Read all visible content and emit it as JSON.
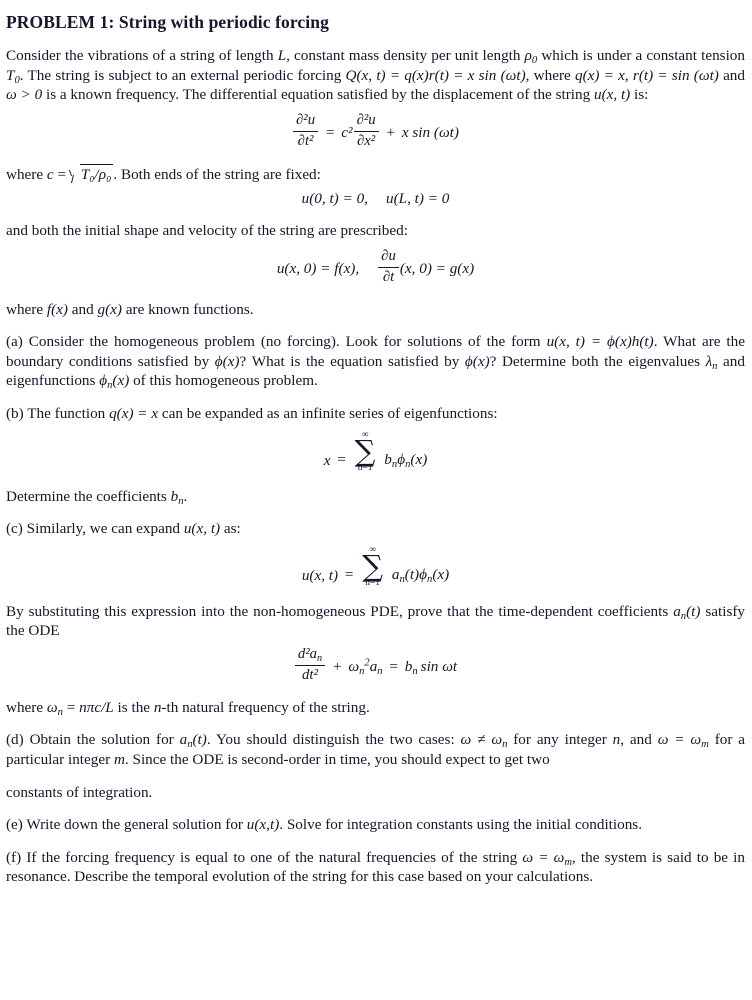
{
  "document": {
    "title": "PROBLEM 1: String with periodic forcing",
    "text_color": "#16162c",
    "background_color": "#ffffff"
  },
  "intro": {
    "p1_a": "Consider the vibrations of a string of length ",
    "p1_L": "L",
    "p1_b": ", constant mass density per unit length ",
    "p1_rho": "ρ",
    "p1_rho_sub": "0",
    "p1_c": " which is under a constant tension ",
    "p1_T": "T",
    "p1_T_sub": "0",
    "p1_d": ". The string is subject to an external periodic forcing ",
    "p1_Q": "Q(x, t) = q(x)r(t) = x sin (ωt)",
    "p1_e": ", where ",
    "p1_qx": "q(x) = x",
    "p1_f": ", ",
    "p1_rt": "r(t) = sin (ωt)",
    "p1_g": " and ",
    "p1_omega": "ω > 0",
    "p1_h": " is a known frequency. The differential equation satisfied by the displacement of the string ",
    "p1_u": "u(x, t)",
    "p1_i": " is:"
  },
  "eq_pde": {
    "label": "wave-equation-with-forcing",
    "lhs_num": "∂²u",
    "lhs_den": "∂t²",
    "equals": "=",
    "coef": "c²",
    "rhs_num": "∂²u",
    "rhs_den": "∂x²",
    "plus": "+",
    "forcing": "x sin (ωt)"
  },
  "wave_speed": {
    "prefix": "where ",
    "c": "c",
    "equals": " = ",
    "radicand": "T₀/ρ₀",
    "suffix": ". Both ends of the string are fixed:"
  },
  "eq_bc": {
    "label": "boundary-conditions",
    "left": "u(0, t) = 0,",
    "right": "u(L, t) = 0"
  },
  "initial_lead": "and both the initial shape and velocity of the string are prescribed:",
  "eq_ic": {
    "label": "initial-conditions",
    "left": "u(x, 0) = f(x),",
    "du_num": "∂u",
    "du_den": "∂t",
    "right": "(x, 0) = g(x)"
  },
  "known_functions": {
    "a": "where ",
    "f": "f(x)",
    "b": " and ",
    "g": "g(x)",
    "c": " are known functions."
  },
  "part_a": {
    "tag": "(a)",
    "t1": " Consider the homogeneous problem (no forcing). Look for solutions of the form ",
    "form": "u(x, t) = ϕ(x)h(t)",
    "t2": ". What are the boundary conditions satisfied by ",
    "phi1": "ϕ(x)",
    "t3": "? What is the equation satisfied by ",
    "phi2": "ϕ(x)",
    "t4": "? Determine both the eigenvalues ",
    "lambda": "λ",
    "lambda_sub": "n",
    "t5": " and eigenfunctions ",
    "phin": "ϕ",
    "phin_sub": "n",
    "phin_arg": "(x)",
    "t6": " of this homogeneous problem."
  },
  "part_b": {
    "tag": "(b)",
    "t1": " The function ",
    "qx": "q(x) = x",
    "t2": " can be expanded as an infinite series of eigenfunctions:"
  },
  "eq_series_x": {
    "label": "eigenfunction-expansion-of-x",
    "lhs": "x",
    "equals": "=",
    "sum_top": "∞",
    "sum_bot": "n=1",
    "term_b": "b",
    "term_b_sub": "n",
    "term_phi": "ϕ",
    "term_phi_sub": "n",
    "term_arg": "(x)"
  },
  "determine_bn": {
    "a": "Determine the coefficients ",
    "b": "b",
    "b_sub": "n",
    "c": "."
  },
  "part_c": {
    "tag": "(c)",
    "t1": " Similarly, we can expand ",
    "u": "u(x, t)",
    "t2": " as:"
  },
  "eq_series_u": {
    "label": "eigenfunction-expansion-of-u",
    "lhs": "u(x, t)",
    "equals": "=",
    "sum_top": "∞",
    "sum_bot": "n=1",
    "term_a": "a",
    "term_a_sub": "n",
    "term_a_arg": "(t)",
    "term_phi": "ϕ",
    "term_phi_sub": "n",
    "term_phi_arg": "(x)"
  },
  "substitute": {
    "t1": "By substituting this expression into the non-homogeneous PDE, prove that the time-dependent coefficients ",
    "an": "a",
    "an_sub": "n",
    "an_arg": "(t)",
    "t2": " satisfy the ODE"
  },
  "eq_ode": {
    "label": "ode-for-an",
    "num": "d²a",
    "num_sub": "n",
    "den": "dt²",
    "plus": "+",
    "omega": "ω",
    "omega_sub": "n",
    "omega_sup": "2",
    "a": "a",
    "a_sub": "n",
    "equals": "=",
    "b": "b",
    "b_sub": "n",
    "rhs": "sin ωt"
  },
  "natural_freq": {
    "a": "where ",
    "omega": "ω",
    "omega_sub": "n",
    "b": " = ",
    "expr": "nπc/L",
    "c": " is the ",
    "n": "n",
    "d": "-th natural frequency of the string."
  },
  "part_d": {
    "tag": "(d)",
    "t1": " Obtain the solution for ",
    "an": "a",
    "an_sub": "n",
    "an_arg": "(t)",
    "t2": ". You should distinguish the two cases: ",
    "case1": "ω ≠ ω",
    "case1_sub": "n",
    "t3": " for any integer ",
    "n": "n",
    "t4": ", and ",
    "case2": "ω = ω",
    "case2_sub": "m",
    "t5": " for a particular integer ",
    "m": "m",
    "t6": ". Since the ODE is second-order in time, you should expect to get two",
    "t7": "constants of integration."
  },
  "part_e": {
    "tag": "(e)",
    "t1": " Write down the general solution for ",
    "u": "u(x,t)",
    "t2": ". Solve for integration constants using the initial conditions."
  },
  "part_f": {
    "tag": "(f)",
    "t1": " If the forcing frequency is equal to one of the natural frequencies of the string ",
    "cond": "ω = ω",
    "cond_sub": "m",
    "t2": ", the system is said to be in resonance. Describe the temporal evolution of the string for this case based on your calculations."
  }
}
